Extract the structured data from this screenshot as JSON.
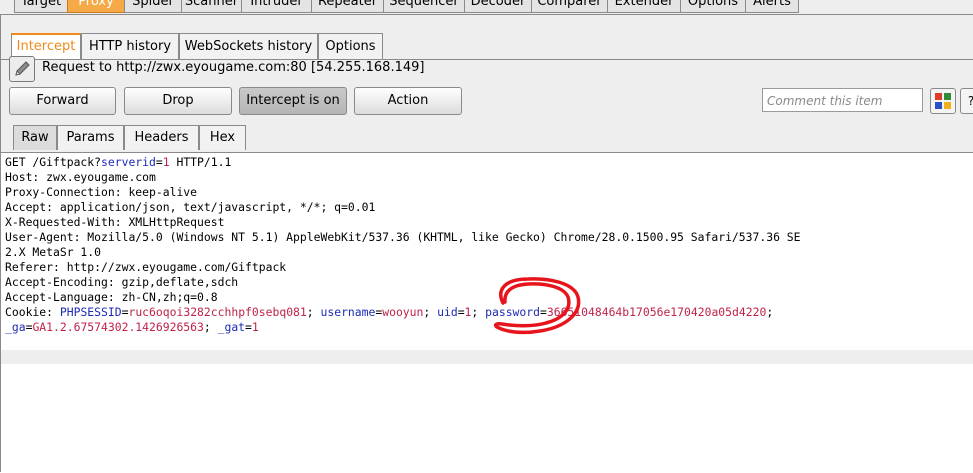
{
  "top_tabs": [
    "Target",
    "Proxy",
    "Spider",
    "Scanner",
    "Intruder",
    "Repeater",
    "Sequencer",
    "Decoder",
    "Comparer",
    "Extender",
    "Options",
    "Alerts"
  ],
  "proxy_tabs": [
    "Intercept",
    "HTTP history",
    "WebSockets history",
    "Options"
  ],
  "request_info": "Request to http://zwx.eyougame.com:80  [54.255.168.149]",
  "buttons": {
    "forward": "Forward",
    "drop": "Drop",
    "intercept": "Intercept is on",
    "action": "Action"
  },
  "comment_placeholder": "Comment this item",
  "more_label": "?",
  "view_tabs": [
    "Raw",
    "Params",
    "Headers",
    "Hex"
  ],
  "request": {
    "l1_a": "GET /Giftpack?",
    "l1_k": "serverid",
    "l1_b": "=",
    "l1_v": "1",
    "l1_c": " HTTP/1.1",
    "l2": "Host: zwx.eyougame.com",
    "l3": "Proxy-Connection: keep-alive",
    "l4": "Accept: application/json, text/javascript, */*; q=0.01",
    "l5": "X-Requested-With: XMLHttpRequest",
    "l6": "User-Agent: Mozilla/5.0 (Windows NT 5.1) AppleWebKit/537.36 (KHTML, like Gecko) Chrome/28.0.1500.95 Safari/537.36 SE",
    "l7": "2.X MetaSr 1.0",
    "l8": "Referer: http://zwx.eyougame.com/Giftpack",
    "l9": "Accept-Encoding: gzip,deflate,sdch",
    "l10": "Accept-Language: zh-CN,zh;q=0.8",
    "cookie_label": "Cookie: ",
    "c1_k": "PHPSESSID",
    "c1_v": "ruc6oqoi3282cchhpf0sebq081",
    "c2_k": "username",
    "c2_v": "wooyun",
    "c3_k": "uid",
    "c3_v": "1",
    "c4_k": "password",
    "c4_v": "36651048464b17056e170420a05d4220",
    "c5_k": "_ga",
    "c5_v": "GA1.2.67574302.1426926563",
    "c6_k": "_gat",
    "c6_v": "1",
    "eq": "=",
    "sep": "; ",
    "sep_end": ";"
  },
  "colors": {
    "active_tab": "#f5a947",
    "cookie_key": "#1d2bb5",
    "cookie_value": "#c0224a",
    "annotation": "#e8141c"
  }
}
